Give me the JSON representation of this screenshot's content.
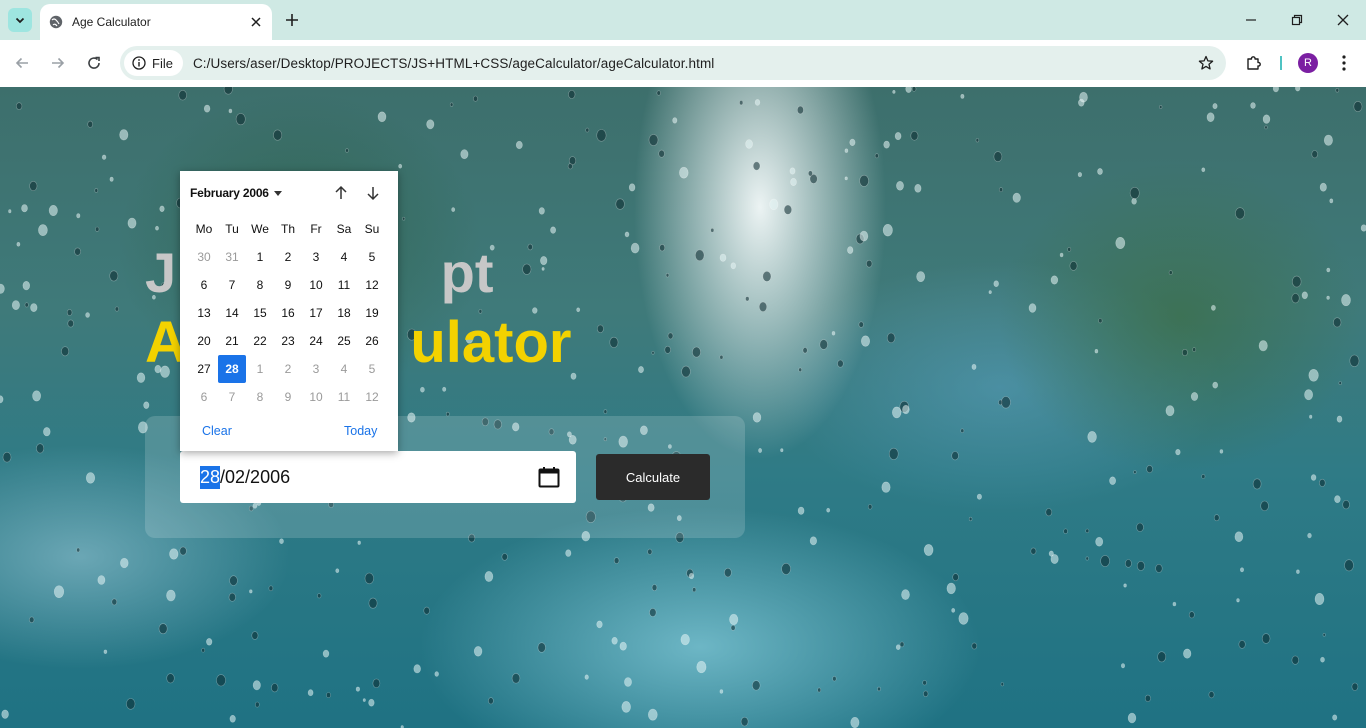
{
  "browser": {
    "tab_title": "Age Calculator",
    "site_chip": "File",
    "url": "C:/Users/aser/Desktop/PROJECTS/JS+HTML+CSS/ageCalculator/ageCalculator.html",
    "profile_initial": "R",
    "profile_color": "#7b1fa2"
  },
  "page": {
    "heading_line1": "J                 pt",
    "heading_line2": "A              ulator",
    "heading_line1_color": "#c7c7c7",
    "heading_line2_color": "#f3d200",
    "date_value": {
      "day": "28",
      "rest": "/02/2006"
    },
    "calculate_label": "Calculate"
  },
  "date_picker": {
    "month_label": "February 2006",
    "weekdays": [
      "Mo",
      "Tu",
      "We",
      "Th",
      "Fr",
      "Sa",
      "Su"
    ],
    "weeks": [
      [
        {
          "d": "30",
          "m": true
        },
        {
          "d": "31",
          "m": true
        },
        {
          "d": "1"
        },
        {
          "d": "2"
        },
        {
          "d": "3"
        },
        {
          "d": "4"
        },
        {
          "d": "5"
        }
      ],
      [
        {
          "d": "6"
        },
        {
          "d": "7"
        },
        {
          "d": "8"
        },
        {
          "d": "9"
        },
        {
          "d": "10"
        },
        {
          "d": "11"
        },
        {
          "d": "12"
        }
      ],
      [
        {
          "d": "13"
        },
        {
          "d": "14"
        },
        {
          "d": "15"
        },
        {
          "d": "16"
        },
        {
          "d": "17"
        },
        {
          "d": "18"
        },
        {
          "d": "19"
        }
      ],
      [
        {
          "d": "20"
        },
        {
          "d": "21"
        },
        {
          "d": "22"
        },
        {
          "d": "23"
        },
        {
          "d": "24"
        },
        {
          "d": "25"
        },
        {
          "d": "26"
        }
      ],
      [
        {
          "d": "27"
        },
        {
          "d": "28",
          "s": true
        },
        {
          "d": "1",
          "m": true
        },
        {
          "d": "2",
          "m": true
        },
        {
          "d": "3",
          "m": true
        },
        {
          "d": "4",
          "m": true
        },
        {
          "d": "5",
          "m": true
        }
      ],
      [
        {
          "d": "6",
          "m": true
        },
        {
          "d": "7",
          "m": true
        },
        {
          "d": "8",
          "m": true
        },
        {
          "d": "9",
          "m": true
        },
        {
          "d": "10",
          "m": true
        },
        {
          "d": "11",
          "m": true
        },
        {
          "d": "12",
          "m": true
        }
      ]
    ],
    "clear_label": "Clear",
    "today_label": "Today",
    "accent_color": "#1a73e8"
  }
}
